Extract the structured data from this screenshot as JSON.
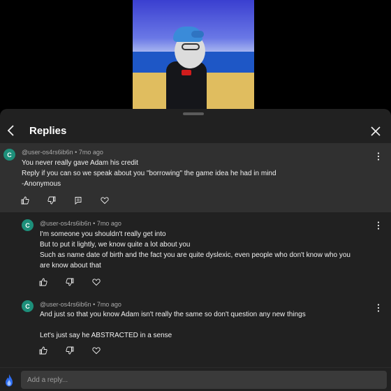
{
  "header": {
    "title": "Replies"
  },
  "comments": [
    {
      "avatar_letter": "C",
      "author": "@user-os4rs6ib6n",
      "time": "7mo ago",
      "lines": [
        "You never really gave Adam his credit",
        "Reply if you can so we speak about you \"borrowing\" the game idea he had in mind",
        "-Anonymous"
      ]
    },
    {
      "avatar_letter": "C",
      "author": "@user-os4rs6ib6n",
      "time": "7mo ago",
      "lines": [
        "I'm someone you shouldn't really get into",
        "But to put it lightly, we know quite a lot about you",
        "Such as name date of birth and the fact you are quite dyslexic, even people who don't know who you",
        "are know about that"
      ]
    },
    {
      "avatar_letter": "C",
      "author": "@user-os4rs6ib6n",
      "time": "7mo ago",
      "lines": [
        "And just so that you know Adam isn't really the same so don't question any new things",
        "",
        "Let's just say he ABSTRACTED in a sense"
      ]
    }
  ],
  "reply_bar": {
    "placeholder": "Add a reply..."
  },
  "colors": {
    "avatar": "#1d8f7a",
    "sheet": "#212121",
    "highlight": "#303030"
  },
  "icons": [
    "chevron-left-icon",
    "close-icon",
    "like-icon",
    "dislike-icon",
    "reply-icon",
    "heart-icon",
    "more-vertical-icon",
    "user-avatar-icon"
  ]
}
